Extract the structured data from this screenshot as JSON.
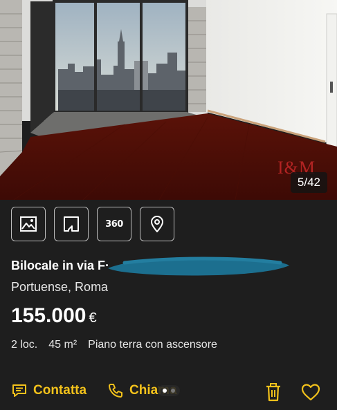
{
  "photo": {
    "counter": "5/42",
    "watermark": "I&M"
  },
  "media_buttons": [
    {
      "icon": "image-icon"
    },
    {
      "icon": "floorplan-icon"
    },
    {
      "icon": "tour-360-icon",
      "label": "360"
    },
    {
      "icon": "map-pin-icon"
    }
  ],
  "listing": {
    "title": "Bilocale in via F·",
    "location": "Portuense, Roma",
    "price": "155.000",
    "currency": "€",
    "rooms": "2 loc.",
    "area": "45 m²",
    "floor": "Piano terra con ascensore"
  },
  "actions": {
    "contact_label": "Contatta",
    "call_label": "Chiama"
  },
  "colors": {
    "accent": "#f3c21b",
    "background": "#1e1e1e",
    "redaction": "#1c6f8f"
  }
}
